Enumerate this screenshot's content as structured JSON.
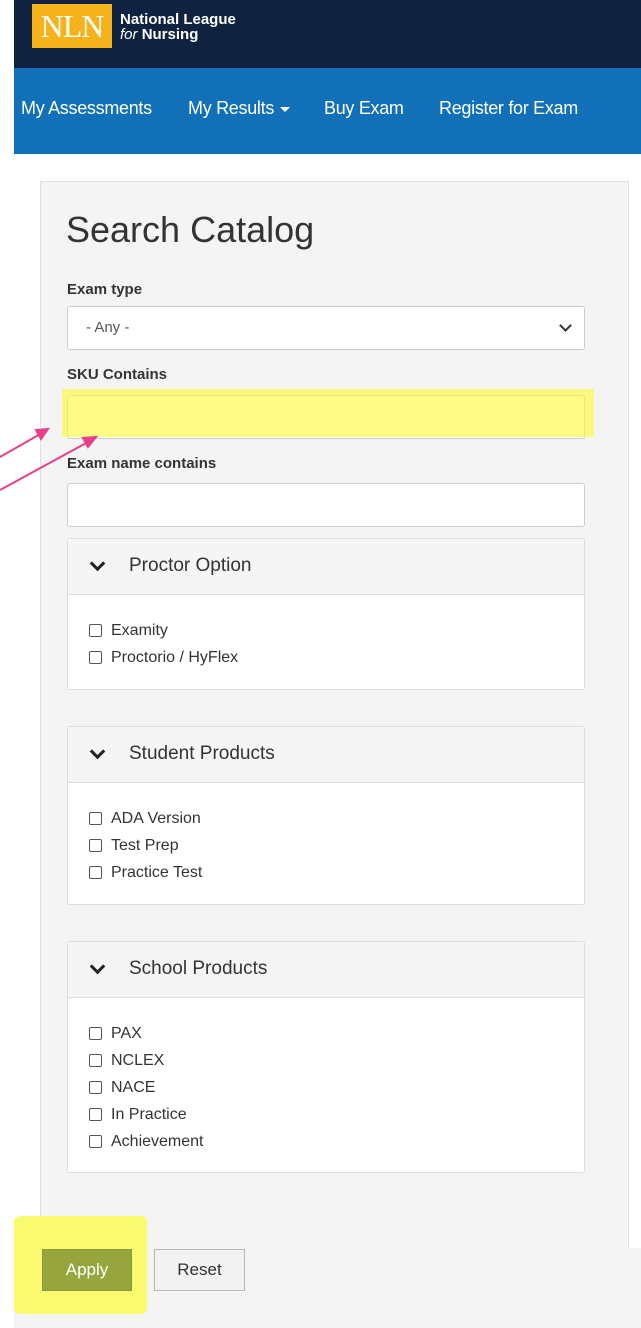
{
  "header": {
    "logo_mark": "NLN",
    "brand_line1": "National League",
    "brand_line2_for": "for",
    "brand_line2_rest": "Nursing"
  },
  "nav": {
    "items": [
      {
        "label": "My Assessments"
      },
      {
        "label": "My Results"
      },
      {
        "label": "Buy Exam"
      },
      {
        "label": "Register for Exam"
      }
    ]
  },
  "search": {
    "title": "Search Catalog",
    "exam_type_label": "Exam type",
    "exam_type_value": "- Any -",
    "sku_label": "SKU Contains",
    "sku_value": "",
    "exam_name_label": "Exam name contains",
    "exam_name_value": ""
  },
  "sections": [
    {
      "title": "Proctor Option",
      "options": [
        "Examity",
        "Proctorio / HyFlex"
      ]
    },
    {
      "title": "Student Products",
      "options": [
        "ADA Version",
        "Test Prep",
        "Practice Test"
      ]
    },
    {
      "title": "School Products",
      "options": [
        "PAX",
        "NCLEX",
        "NACE",
        "In Practice",
        "Achievement"
      ]
    }
  ],
  "buttons": {
    "apply": "Apply",
    "reset": "Reset"
  },
  "colors": {
    "header_dark": "#0f2340",
    "nav_blue": "#1170b8",
    "logo_gold": "#f6b21b",
    "apply_green": "#97a53e",
    "highlight_yellow": "#fafa6e",
    "annotation_arrow": "#e83e8c"
  }
}
